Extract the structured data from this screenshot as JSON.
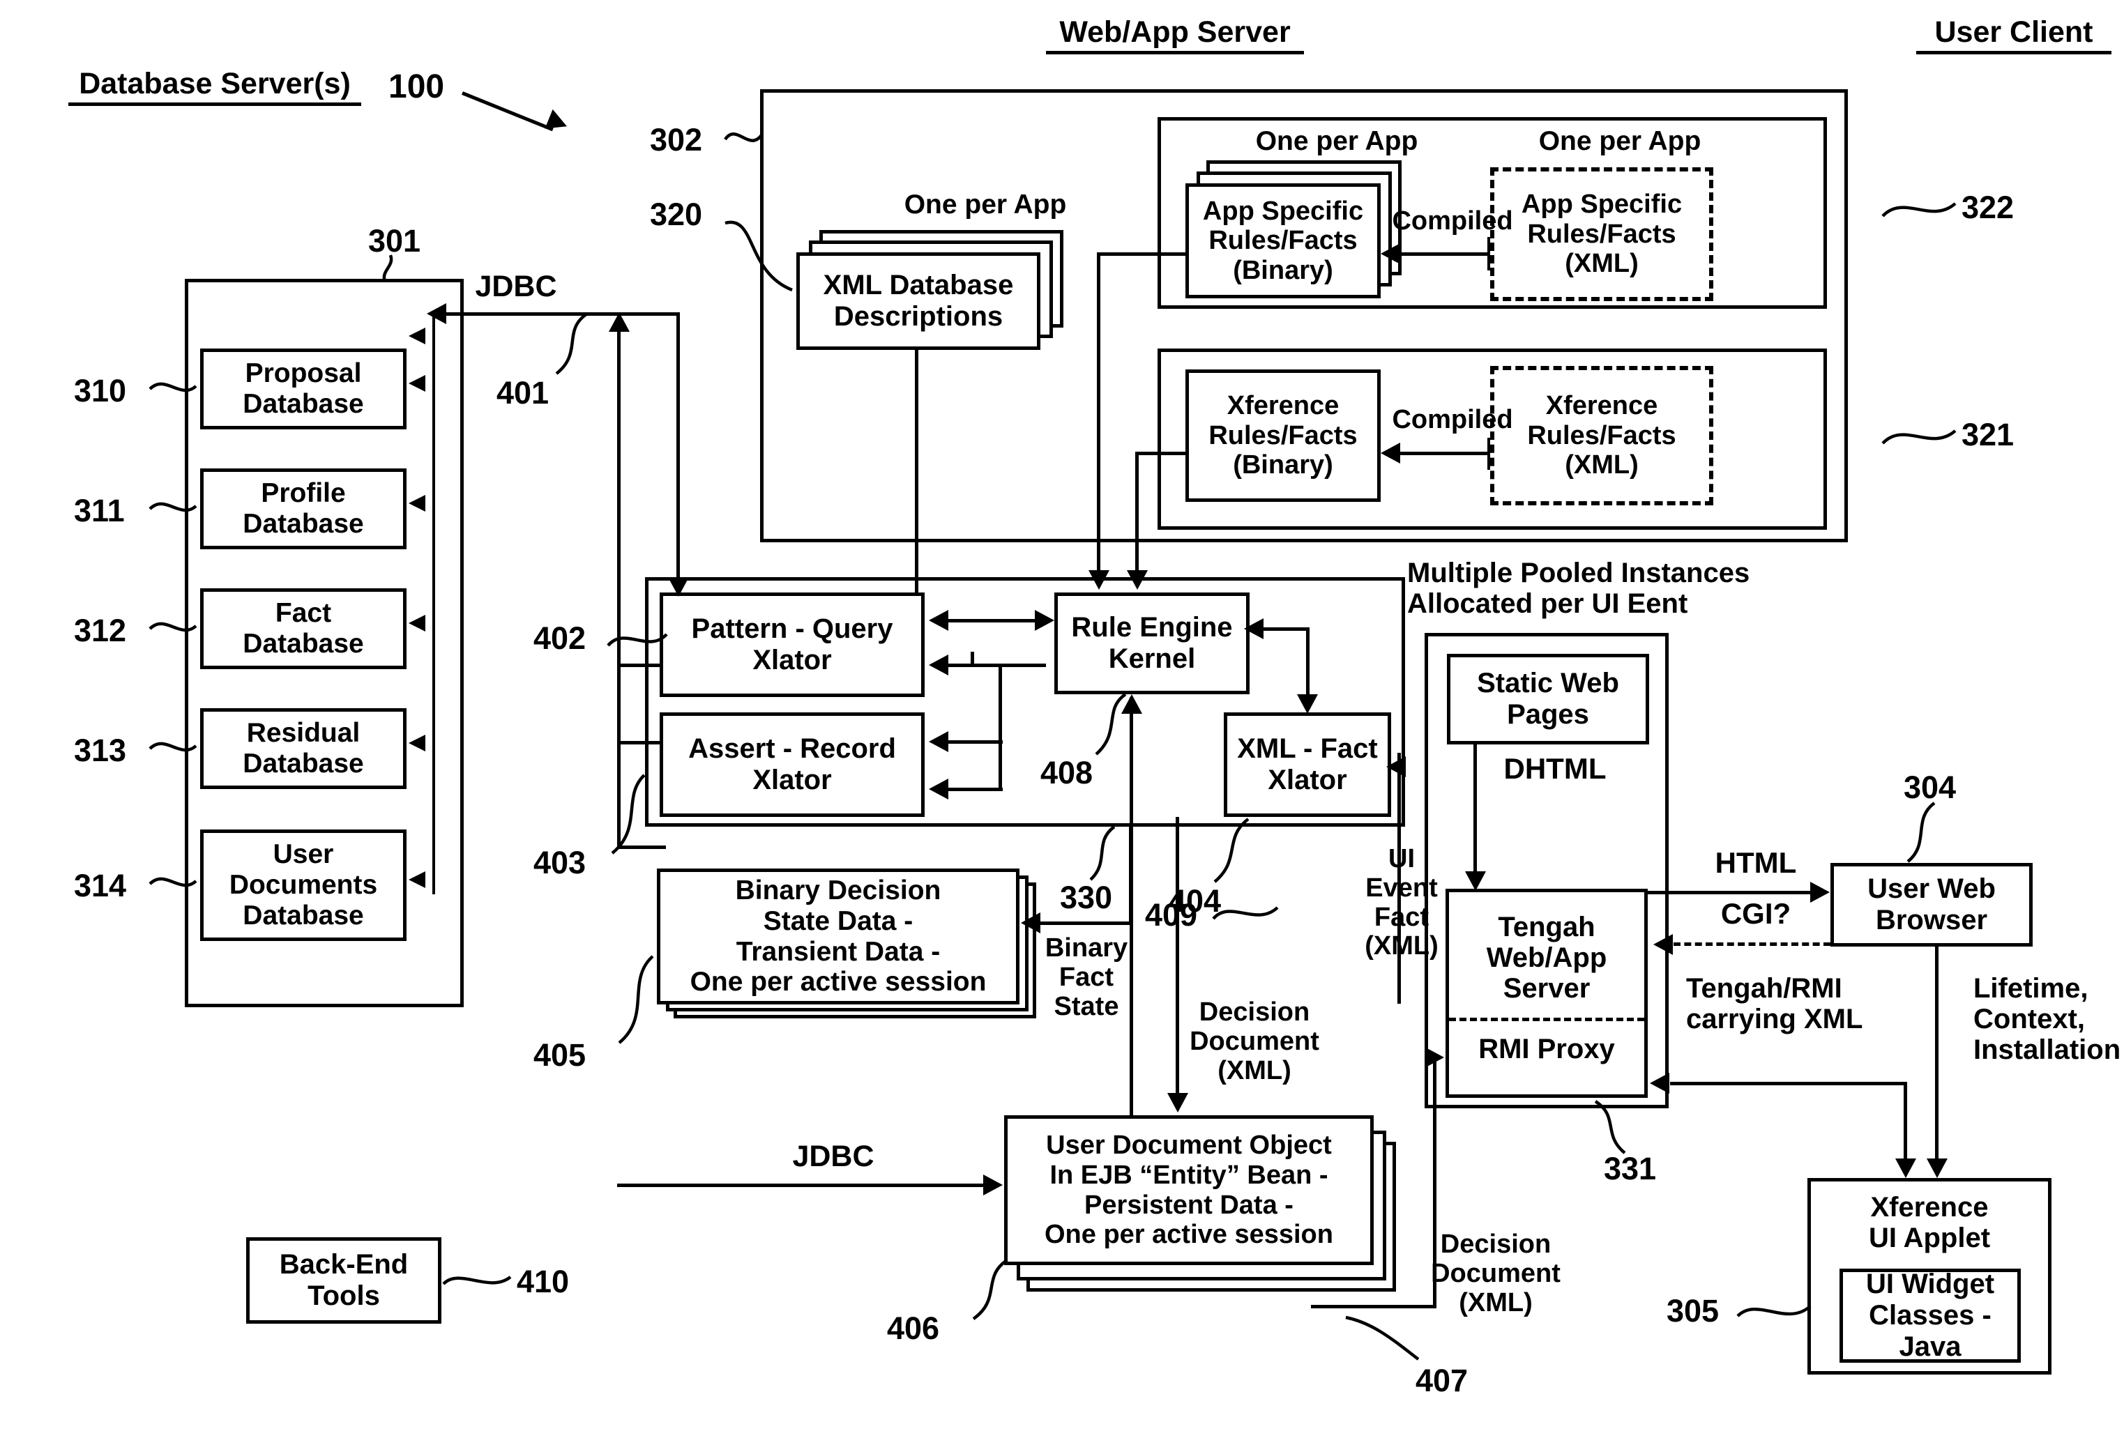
{
  "figure": {
    "number": "100",
    "headings": {
      "database_server": "Database Server(s)",
      "web_app_server": "Web/App Server",
      "user_client": "User Client"
    }
  },
  "database_server": {
    "ref": "301",
    "items": [
      {
        "ref": "310",
        "label": "Proposal\nDatabase"
      },
      {
        "ref": "311",
        "label": "Profile\nDatabase"
      },
      {
        "ref": "312",
        "label": "Fact\nDatabase"
      },
      {
        "ref": "313",
        "label": "Residual\nDatabase"
      },
      {
        "ref": "314",
        "label": "User\nDocuments\nDatabase"
      }
    ],
    "back_end_tools": {
      "ref": "410",
      "label": "Back-End\nTools"
    }
  },
  "web_app_server": {
    "ref": "302",
    "xml_database_descriptions": {
      "ref": "320",
      "label": "XML Database\nDescriptions",
      "caption": "One per App"
    },
    "app_specific_group": {
      "ref": "322",
      "caption_binary": "One per App",
      "caption_xml": "One per App",
      "binary_label": "App Specific\nRules/Facts\n(Binary)",
      "xml_label": "App Specific\nRules/Facts\n(XML)",
      "arrow_label": "Compiled"
    },
    "xference_group": {
      "ref": "321",
      "binary_label": "Xference\nRules/Facts\n(Binary)",
      "xml_label": "Xference\nRules/Facts\n(XML)",
      "arrow_label": "Compiled"
    },
    "engine": {
      "pattern_query_xlator": {
        "ref": "402",
        "label": "Pattern - Query\nXlator"
      },
      "assert_record_xlator": {
        "ref": "403",
        "label": "Assert - Record\nXlator"
      },
      "rule_engine_kernel": {
        "ref": "408",
        "label": "Rule Engine\nKernel"
      },
      "xml_fact_xlator": {
        "ref": "404",
        "label": "XML - Fact\nXlator"
      }
    },
    "binary_decision_state": {
      "ref": "405",
      "label": "Binary Decision\nState Data -\nTransient Data -\nOne per active session",
      "incoming_ref": "330",
      "incoming_label": "Binary\nFact\nState"
    },
    "user_document_object": {
      "ref": "406",
      "label": "User Document Object\nIn EJB “Entity” Bean -\nPersistent Data -\nOne per active session",
      "incoming_ref": "409",
      "incoming_label": "Decision\nDocument\n(XML)",
      "outgoing_ref": "407",
      "outgoing_label": "Decision\nDocument\n(XML)"
    },
    "web_tier": {
      "ref": "331",
      "caption": "Multiple Pooled Instances\nAllocated per UI Eent",
      "static_web_pages": "Static Web\nPages",
      "dhtml_label": "DHTML",
      "tengah_label": "Tengah\nWeb/App\nServer",
      "rmi_proxy_label": "RMI Proxy"
    },
    "ui_event_fact_label": "UI\nEvent\nFact\n(XML)",
    "jdbc_top": {
      "ref": "401",
      "label": "JDBC"
    },
    "jdbc_bottom": {
      "label": "JDBC"
    }
  },
  "user_client": {
    "user_web_browser": {
      "ref": "304",
      "label": "User Web\nBrowser"
    },
    "xference_ui_applet": {
      "ref": "305",
      "label": "Xference\nUI Applet",
      "ui_widget_classes": "UI Widget\nClasses -\nJava"
    },
    "links": {
      "html": "HTML",
      "cgi": "CGI?",
      "tengah_rmi": "Tengah/RMI\ncarrying XML",
      "lifetime": "Lifetime,\nContext,\nInstallation"
    }
  }
}
